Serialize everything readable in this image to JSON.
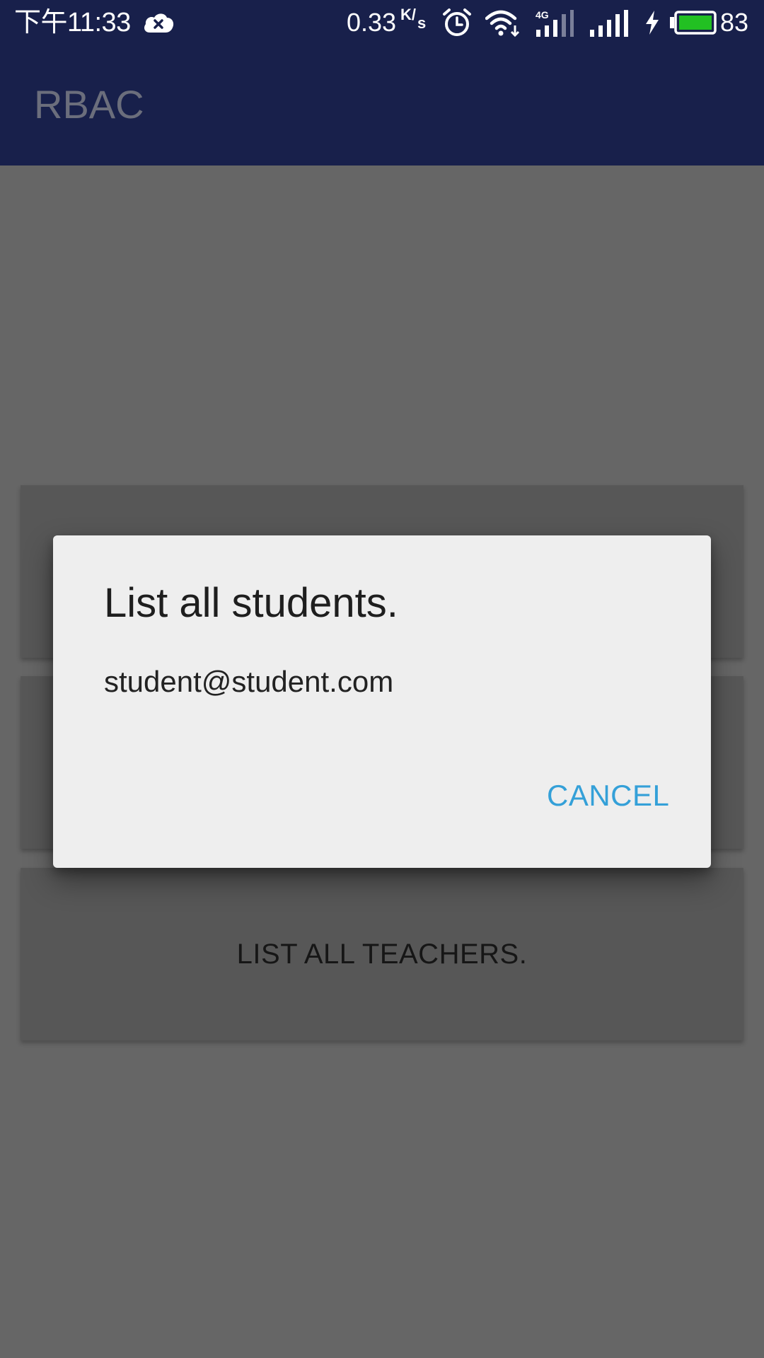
{
  "status_bar": {
    "time": "下午11:33",
    "network_speed": "0.33",
    "speed_unit_top": "K",
    "speed_unit_bottom": "s",
    "network_type": "4G",
    "battery_percent": "83",
    "battery_level": 0.83,
    "battery_color": "#22c022",
    "icons": [
      "cloud-error-icon",
      "alarm-icon",
      "wifi-icon",
      "signal-4g-icon",
      "signal-icon",
      "charging-icon",
      "battery-icon"
    ]
  },
  "app_bar": {
    "title": "RBAC",
    "background": "#18204b"
  },
  "content": {
    "buttons": [
      {
        "label": ""
      },
      {
        "label": ""
      },
      {
        "label": "LIST ALL TEACHERS."
      }
    ]
  },
  "dialog": {
    "title": "List all students.",
    "message": "student@student.com",
    "cancel_label": "CANCEL",
    "accent_color": "#34a0d8"
  }
}
